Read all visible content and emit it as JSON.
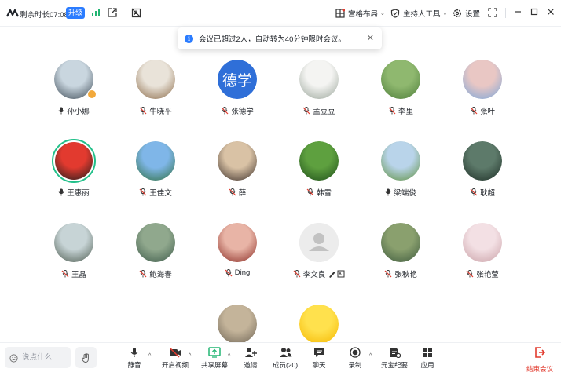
{
  "topbar": {
    "timer": "剩余时长07:08",
    "upgrade": "升级",
    "layout": "宫格布局",
    "host_tools": "主持人工具",
    "settings": "设置"
  },
  "notice": {
    "text": "会议已超过2人，自动转为40分钟限时会议。"
  },
  "participants": [
    {
      "name": "孙小娜",
      "mic": "on",
      "host": true,
      "colors": [
        "#c9d6df",
        "#3d4a55"
      ]
    },
    {
      "name": "牛晓平",
      "mic": "muted",
      "colors": [
        "#e9e3d9",
        "#8b6a48"
      ]
    },
    {
      "name": "张德学",
      "mic": "muted",
      "avatar_text": "德学",
      "colors": [
        "#2f6fd8",
        "#2f6fd8"
      ]
    },
    {
      "name": "孟豆豆",
      "mic": "muted",
      "colors": [
        "#f4f4f2",
        "#9aa59a"
      ]
    },
    {
      "name": "李里",
      "mic": "muted",
      "colors": [
        "#8fb86f",
        "#4d7d3a"
      ]
    },
    {
      "name": "张叶",
      "mic": "muted",
      "colors": [
        "#e9c7c4",
        "#7aa6d9"
      ]
    },
    {
      "name": "王惠丽",
      "mic": "on",
      "speaking": true,
      "colors": [
        "#e23a2f",
        "#1c1c1c"
      ]
    },
    {
      "name": "王佳文",
      "mic": "muted",
      "colors": [
        "#7fb6e8",
        "#2e6e3e"
      ]
    },
    {
      "name": "薛",
      "mic": "muted",
      "colors": [
        "#d9c2a5",
        "#3b2f2a"
      ]
    },
    {
      "name": "韩雪",
      "mic": "muted",
      "colors": [
        "#5ea03f",
        "#1e4d1a"
      ]
    },
    {
      "name": "梁端俊",
      "mic": "on",
      "colors": [
        "#b9d4ea",
        "#5d8f3c"
      ]
    },
    {
      "name": "耿超",
      "mic": "muted",
      "colors": [
        "#5d7a6a",
        "#1d2e26"
      ]
    },
    {
      "name": "王晶",
      "mic": "muted",
      "colors": [
        "#c7d4d6",
        "#4d5b4f"
      ]
    },
    {
      "name": "鲍海春",
      "mic": "muted",
      "colors": [
        "#90a88d",
        "#3d5a4a"
      ]
    },
    {
      "name": "Ding",
      "mic": "muted",
      "colors": [
        "#e8b4a6",
        "#8a2b24"
      ]
    },
    {
      "name": "李文良",
      "mic": "muted",
      "placeholder": true,
      "extra": "pen",
      "colors": [
        "#ececec",
        "#c9c9c9"
      ]
    },
    {
      "name": "张秋艳",
      "mic": "muted",
      "colors": [
        "#8aa06e",
        "#3e5a3e"
      ]
    },
    {
      "name": "张艳莹",
      "mic": "muted",
      "colors": [
        "#f3e0e4",
        "#c9a0a6"
      ]
    },
    {
      "name": "",
      "mic": "none",
      "colors": [
        "#c4b49a",
        "#6e6455"
      ]
    },
    {
      "name": "",
      "mic": "none",
      "colors": [
        "#ffe14d",
        "#f5b700"
      ]
    }
  ],
  "bottombar": {
    "chat_placeholder": "说点什么...",
    "tools": [
      {
        "label": "静音",
        "icon": "microphone-icon"
      },
      {
        "label": "开启视频",
        "icon": "video-off-icon"
      },
      {
        "label": "共享屏幕",
        "icon": "share-screen-icon"
      },
      {
        "label": "邀请",
        "icon": "invite-icon"
      },
      {
        "label": "成员(20)",
        "icon": "members-icon"
      },
      {
        "label": "聊天",
        "icon": "chat-icon"
      },
      {
        "label": "录制",
        "icon": "record-icon"
      },
      {
        "label": "元宝纪要",
        "icon": "minutes-icon"
      },
      {
        "label": "应用",
        "icon": "apps-icon"
      }
    ],
    "end": "结束会议"
  }
}
